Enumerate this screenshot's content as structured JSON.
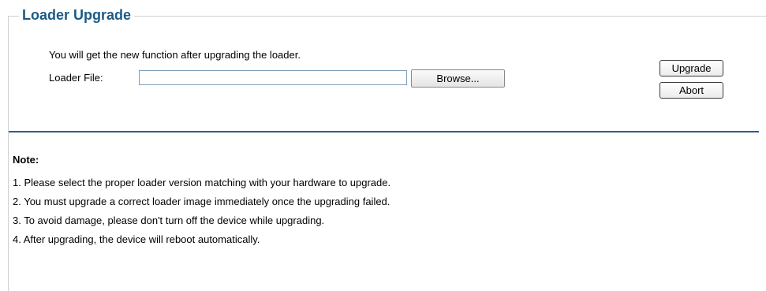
{
  "section": {
    "title": "Loader Upgrade"
  },
  "form": {
    "intro_text": "You will get the new function after upgrading the loader.",
    "file_label": "Loader File:",
    "file_value": "",
    "browse_label": "Browse...",
    "upgrade_label": "Upgrade",
    "abort_label": "Abort"
  },
  "notes": {
    "title": "Note:",
    "items": [
      "1. Please select the proper loader version matching with your hardware to upgrade.",
      "2. You must upgrade a correct loader image immediately once the upgrading failed.",
      "3. To avoid damage, please don't turn off the device while upgrading.",
      "4. After upgrading, the device will reboot automatically."
    ]
  },
  "colors": {
    "title_color": "#1c5a86",
    "divider_color": "#2a5f8e",
    "fieldset_border": "#d0d0d0"
  }
}
